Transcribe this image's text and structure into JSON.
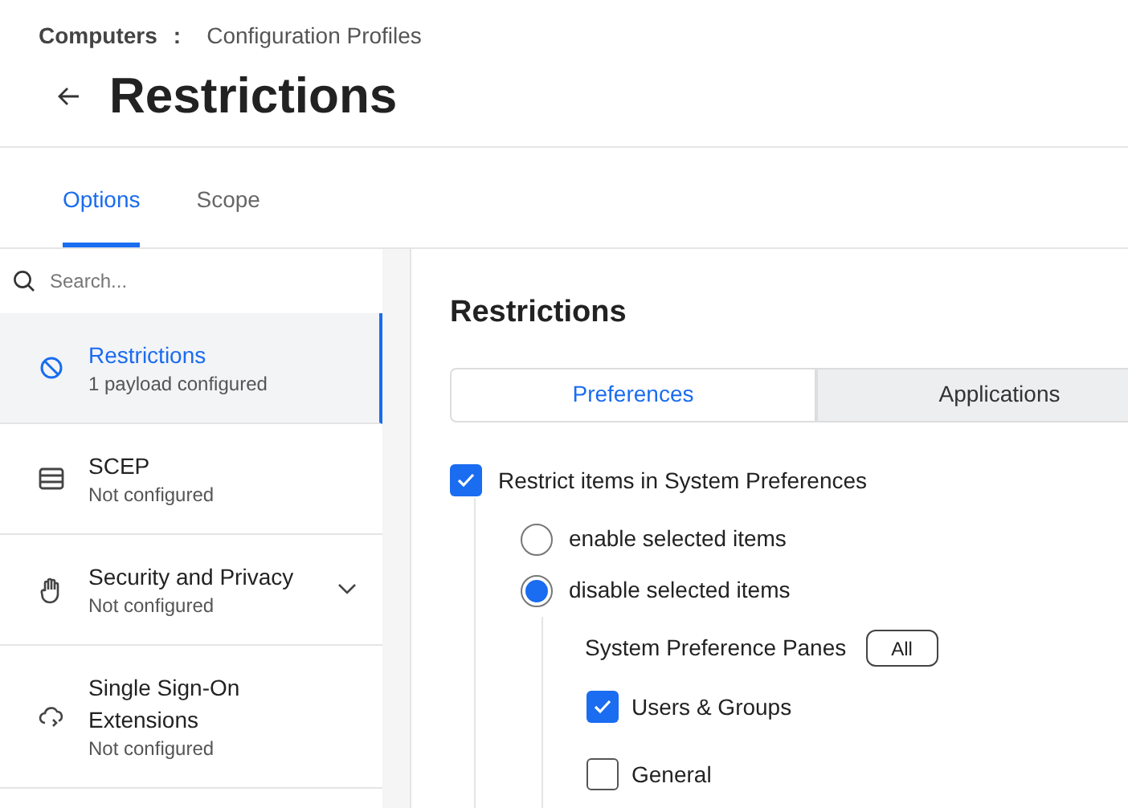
{
  "breadcrumb": {
    "parent": "Computers",
    "separator": ":",
    "current": "Configuration Profiles"
  },
  "title": "Restrictions",
  "tabs": [
    {
      "label": "Options",
      "selected": true
    },
    {
      "label": "Scope",
      "selected": false
    }
  ],
  "search": {
    "placeholder": "Search..."
  },
  "payloads": [
    {
      "name": "Restrictions",
      "status": "1 payload configured",
      "kind": "payload",
      "selected": true
    },
    {
      "name": "SCEP",
      "status": "Not configured",
      "kind": "payload",
      "selected": false
    },
    {
      "name": "Security and Privacy",
      "status": "Not configured",
      "kind": "group",
      "selected": false
    },
    {
      "name": "Single Sign-On Extensions",
      "status": "Not configured",
      "kind": "payload",
      "selected": false
    }
  ],
  "section_title": "Restrictions",
  "segments": [
    {
      "label": "Preferences",
      "selected": true
    },
    {
      "label": "Applications",
      "selected": false
    }
  ],
  "restrict": {
    "label": "Restrict items in System Preferences",
    "checked": true
  },
  "modes": [
    {
      "label": "enable selected items",
      "selected": false
    },
    {
      "label": "disable selected items",
      "selected": true
    }
  ],
  "panes_label": "System Preference Panes",
  "all_button": "All",
  "panes": [
    {
      "label": "Users & Groups",
      "checked": true
    },
    {
      "label": "General",
      "checked": false
    }
  ]
}
